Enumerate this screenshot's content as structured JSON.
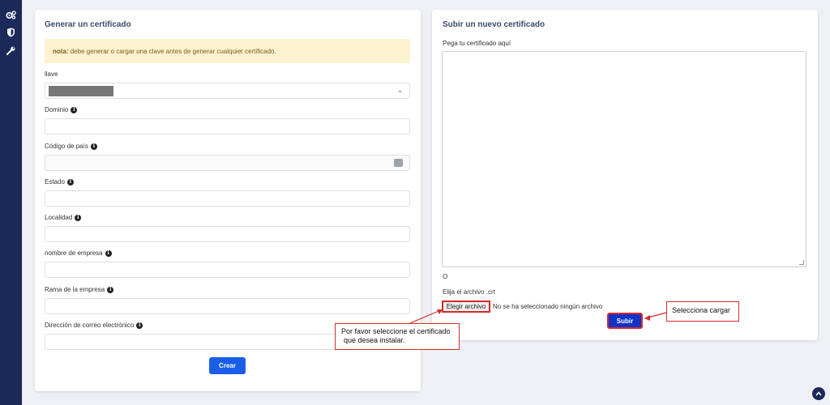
{
  "sidebar": {
    "icons": [
      "gears-icon",
      "shield-icon",
      "wrench-icon"
    ]
  },
  "generate": {
    "title": "Generar un certificado",
    "note_bold": "nota:",
    "note_text": " debe generar o cargar una clave antes de generar cualquier certificado.",
    "key_label": "llave",
    "domain_label": "Dominio",
    "country_label": "Código de país",
    "state_label": "Estado",
    "city_label": "Localidad",
    "company_label": "nombre de empresa",
    "branch_label": "Rama de la empresa",
    "email_label": "Dirección de correo electrónico",
    "create_button": "Crear"
  },
  "upload": {
    "title": "Subir un nuevo certificado",
    "paste_label": "Pega tu certificado aquí",
    "or_text": "O",
    "choose_label": "Elija el archivo .crt",
    "choose_button": "Elegir archivo",
    "no_file_text": "No se ha seleccionado ningún archivo",
    "submit_button": "Subir"
  },
  "annotations": {
    "choose_callout_line1": "Por favor seleccione el certificado",
    "choose_callout_line2": "que desea instalar.",
    "upload_callout": "Selecciona cargar",
    "accent_color": "#d32a2a"
  }
}
